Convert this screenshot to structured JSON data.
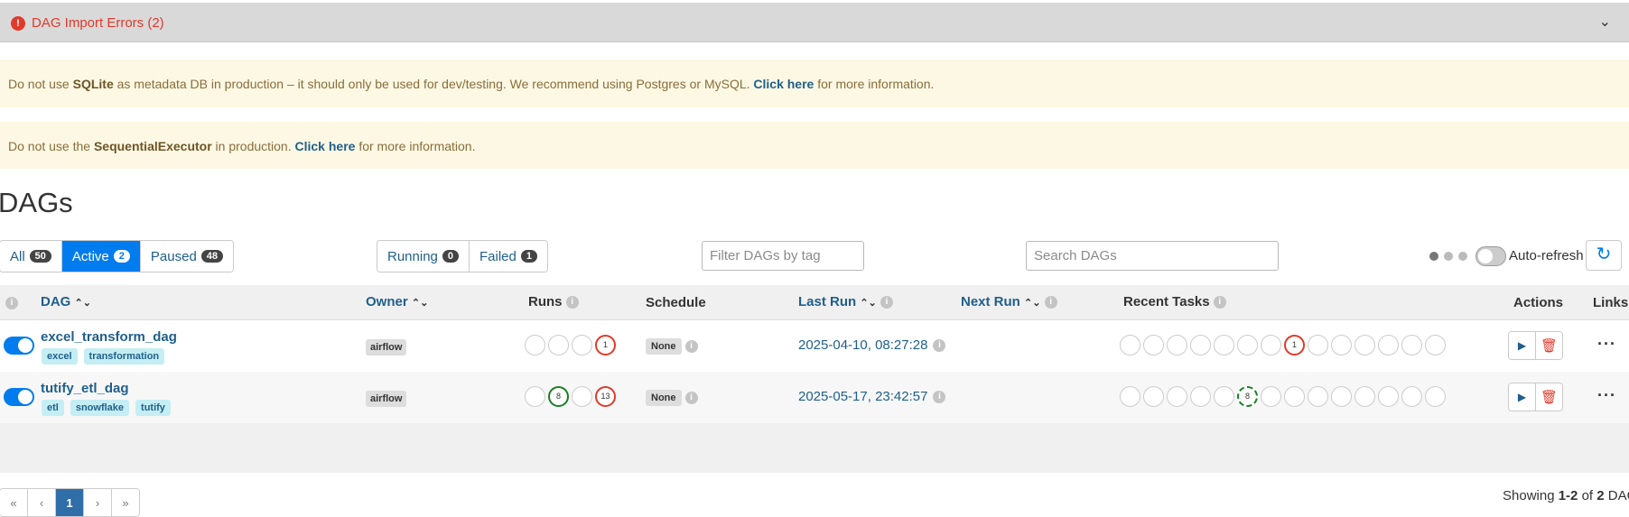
{
  "import_errors": {
    "title": "DAG Import Errors (2)",
    "icon": "!",
    "chevron": "⌄"
  },
  "notices": [
    {
      "pre": "Do not use ",
      "bold": "SQLite",
      "mid": " as metadata DB in production – it should only be used for dev/testing. We recommend using Postgres or MySQL. ",
      "link": "Click here",
      "post": " for more information."
    },
    {
      "pre": "Do not use the ",
      "bold": "SequentialExecutor",
      "mid": " in production. ",
      "link": "Click here",
      "post": " for more information."
    }
  ],
  "page_title": "DAGs",
  "filters": {
    "all": {
      "label": "All",
      "count": "50"
    },
    "active": {
      "label": "Active",
      "count": "2"
    },
    "paused": {
      "label": "Paused",
      "count": "48"
    },
    "running": {
      "label": "Running",
      "count": "0"
    },
    "failed": {
      "label": "Failed",
      "count": "1"
    },
    "tag_placeholder": "Filter DAGs by tag",
    "search_placeholder": "Search DAGs"
  },
  "auto_refresh_label": "Auto-refresh",
  "refresh_icon": "↻",
  "info_glyph": "i",
  "sort_glyph": "⌃⌄",
  "columns": {
    "dag": "DAG",
    "owner": "Owner",
    "runs": "Runs",
    "schedule": "Schedule",
    "last_run": "Last Run",
    "next_run": "Next Run",
    "recent_tasks": "Recent Tasks",
    "actions": "Actions",
    "links": "Links"
  },
  "dags": [
    {
      "name": "excel_transform_dag",
      "tags": [
        "excel",
        "transformation"
      ],
      "owner": "airflow",
      "runs": [
        "",
        "",
        "",
        "1"
      ],
      "schedule": "None",
      "last_run": "2025-04-10, 08:27:28",
      "recent_tasks": [
        "",
        "",
        "",
        "",
        "",
        "",
        "",
        "1",
        "",
        "",
        "",
        "",
        "",
        ""
      ]
    },
    {
      "name": "tutify_etl_dag",
      "tags": [
        "etl",
        "snowflake",
        "tutify"
      ],
      "owner": "airflow",
      "runs": [
        "",
        "8",
        "",
        "13"
      ],
      "schedule": "None",
      "last_run": "2025-05-17, 23:42:57",
      "recent_tasks": [
        "",
        "",
        "",
        "",
        "",
        "8",
        "",
        "",
        "",
        "",
        "",
        "",
        "",
        ""
      ]
    }
  ],
  "actions": {
    "trigger_icon": "▶",
    "delete_icon": "🗑",
    "more_icon": "···"
  },
  "pagination": {
    "first": "«",
    "prev": "‹",
    "current": "1",
    "next": "›",
    "last": "»"
  },
  "showing": {
    "pre": "Showing ",
    "range": "1-2",
    "mid": " of ",
    "total": "2",
    "post": " DAG"
  }
}
